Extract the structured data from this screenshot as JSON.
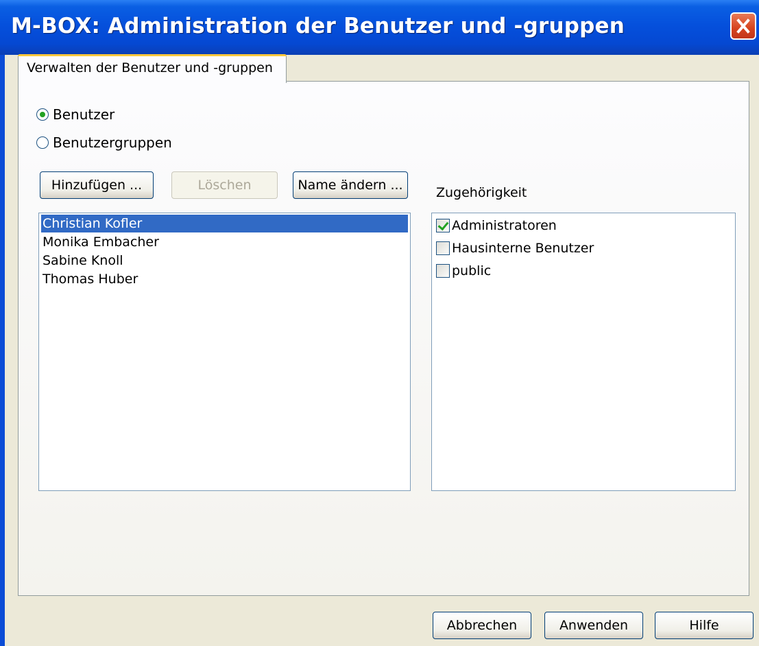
{
  "window": {
    "title": "M-BOX: Administration der Benutzer und -gruppen",
    "close_icon": "close-icon",
    "accent_color": "#0550dc"
  },
  "tab": {
    "label": "Verwalten der Benutzer und -gruppen"
  },
  "mode": {
    "users_label": "Benutzer",
    "groups_label": "Benutzergruppen",
    "selected": "Benutzer"
  },
  "actions": {
    "add_label": "Hinzufügen ...",
    "delete_label": "Löschen",
    "rename_label": "Name ändern ..."
  },
  "users": {
    "items": [
      "Christian Kofler",
      "Monika Embacher",
      "Sabine Knoll",
      "Thomas Huber"
    ],
    "selected_index": 0
  },
  "membership": {
    "title": "Zugehörigkeit",
    "groups": [
      {
        "name": "Administratoren",
        "checked": true
      },
      {
        "name": "Hausinterne Benutzer",
        "checked": false
      },
      {
        "name": "public",
        "checked": false
      }
    ]
  },
  "footer": {
    "cancel_label": "Abbrechen",
    "apply_label": "Anwenden",
    "help_label": "Hilfe"
  }
}
